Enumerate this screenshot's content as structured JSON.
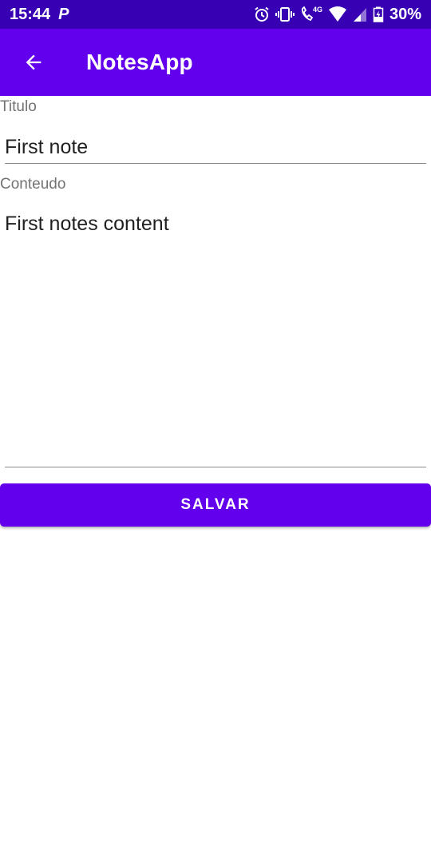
{
  "status_bar": {
    "time": "15:44",
    "app_notification_icon": "p-icon",
    "network_label": "4G",
    "battery_percent": "30%",
    "icons": [
      "alarm-icon",
      "vibrate-icon",
      "volte-call-icon",
      "wifi-icon",
      "cell-signal-icon",
      "battery-charging-icon"
    ]
  },
  "app_bar": {
    "title": "NotesApp",
    "back_icon": "arrow-back-icon"
  },
  "form": {
    "title_label": "Titulo",
    "title_value": "First note",
    "content_label": "Conteudo",
    "content_value": "First notes content",
    "save_label": "SALVAR"
  },
  "colors": {
    "status_bar": "#3700b3",
    "primary": "#6200ee",
    "label_text": "#737373",
    "input_text": "#212121"
  }
}
